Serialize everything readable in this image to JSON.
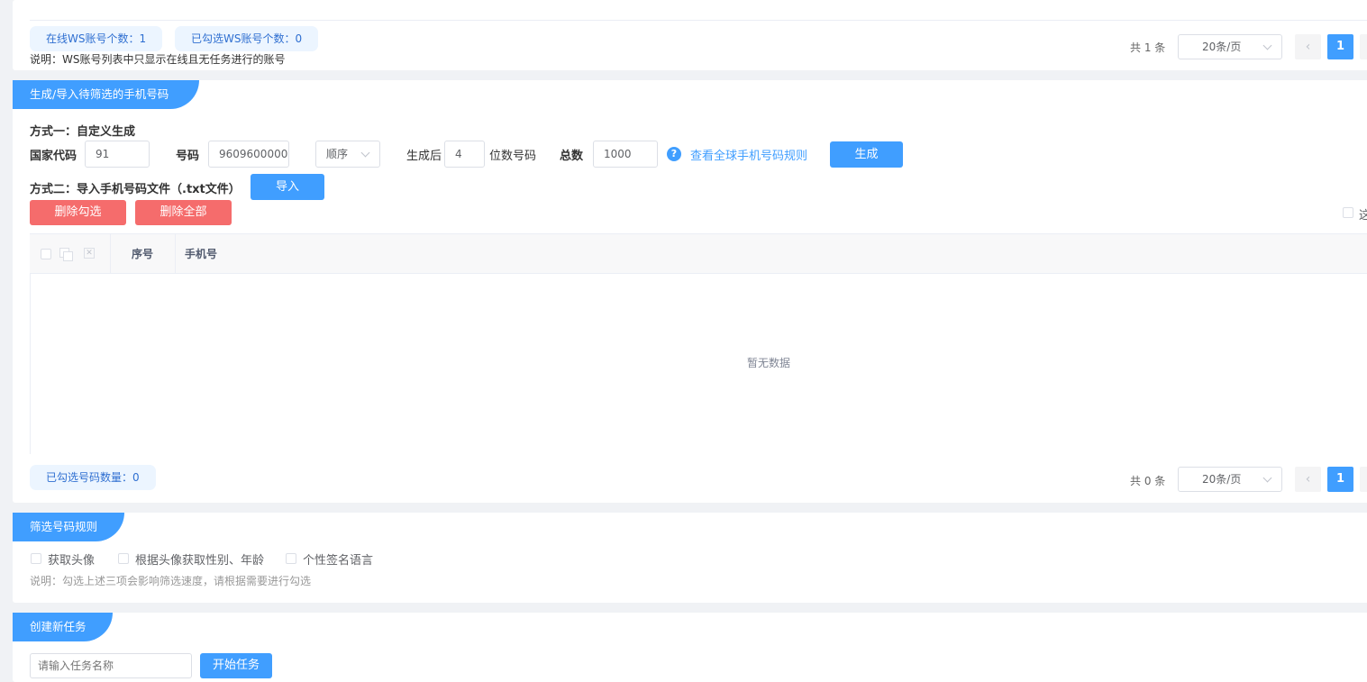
{
  "accounts_section": {
    "online_count_label": "在线WS账号个数：1",
    "selected_count_label": "已勾选WS账号个数：0",
    "note": "说明：WS账号列表中只显示在线且无任务进行的账号",
    "pagination": {
      "total": "共 1 条",
      "page_size": "20条/页",
      "prev": "‹",
      "current_page": "1"
    }
  },
  "generate_section": {
    "title": "生成/导入待筛选的手机号码",
    "method_one_label": "方式一：自定义生成",
    "country_code_label": "国家代码",
    "country_code_value": "91",
    "number_label": "号码",
    "number_value": "9609600000",
    "order_select": "顺序",
    "after_label": "生成后",
    "digits_value": "4",
    "digits_suffix": "位数号码",
    "total_label": "总数",
    "total_value": "1000",
    "help_icon": "question-circle-icon",
    "help_icon_glyph": "?",
    "rules_link": "查看全球手机号码规则",
    "generate_button": "生成",
    "method_two_label": "方式二：导入手机号码文件（.txt文件）",
    "import_button": "导入",
    "delete_selected_button": "删除勾选",
    "delete_all_button": "删除全部",
    "table": {
      "columns": [
        "序号",
        "手机号"
      ],
      "empty_text": "暂无数据"
    },
    "selected_numbers_label": "已勾选号码数量：0",
    "pagination": {
      "total": "共 0 条",
      "page_size": "20条/页",
      "prev": "‹",
      "current_page": "1"
    }
  },
  "filter_section": {
    "title": "筛选号码规则",
    "options": [
      "获取头像",
      "根据头像获取性别、年龄",
      "个性签名语言"
    ],
    "note": "说明：勾选上述三项会影响筛选速度，请根据需要进行勾选"
  },
  "task_section": {
    "title": "创建新任务",
    "task_name_placeholder": "请输入任务名称",
    "start_button": "开始任务"
  },
  "colors": {
    "primary": "#409eff",
    "danger": "#f56c6c",
    "pill_bg": "#ecf5ff"
  }
}
